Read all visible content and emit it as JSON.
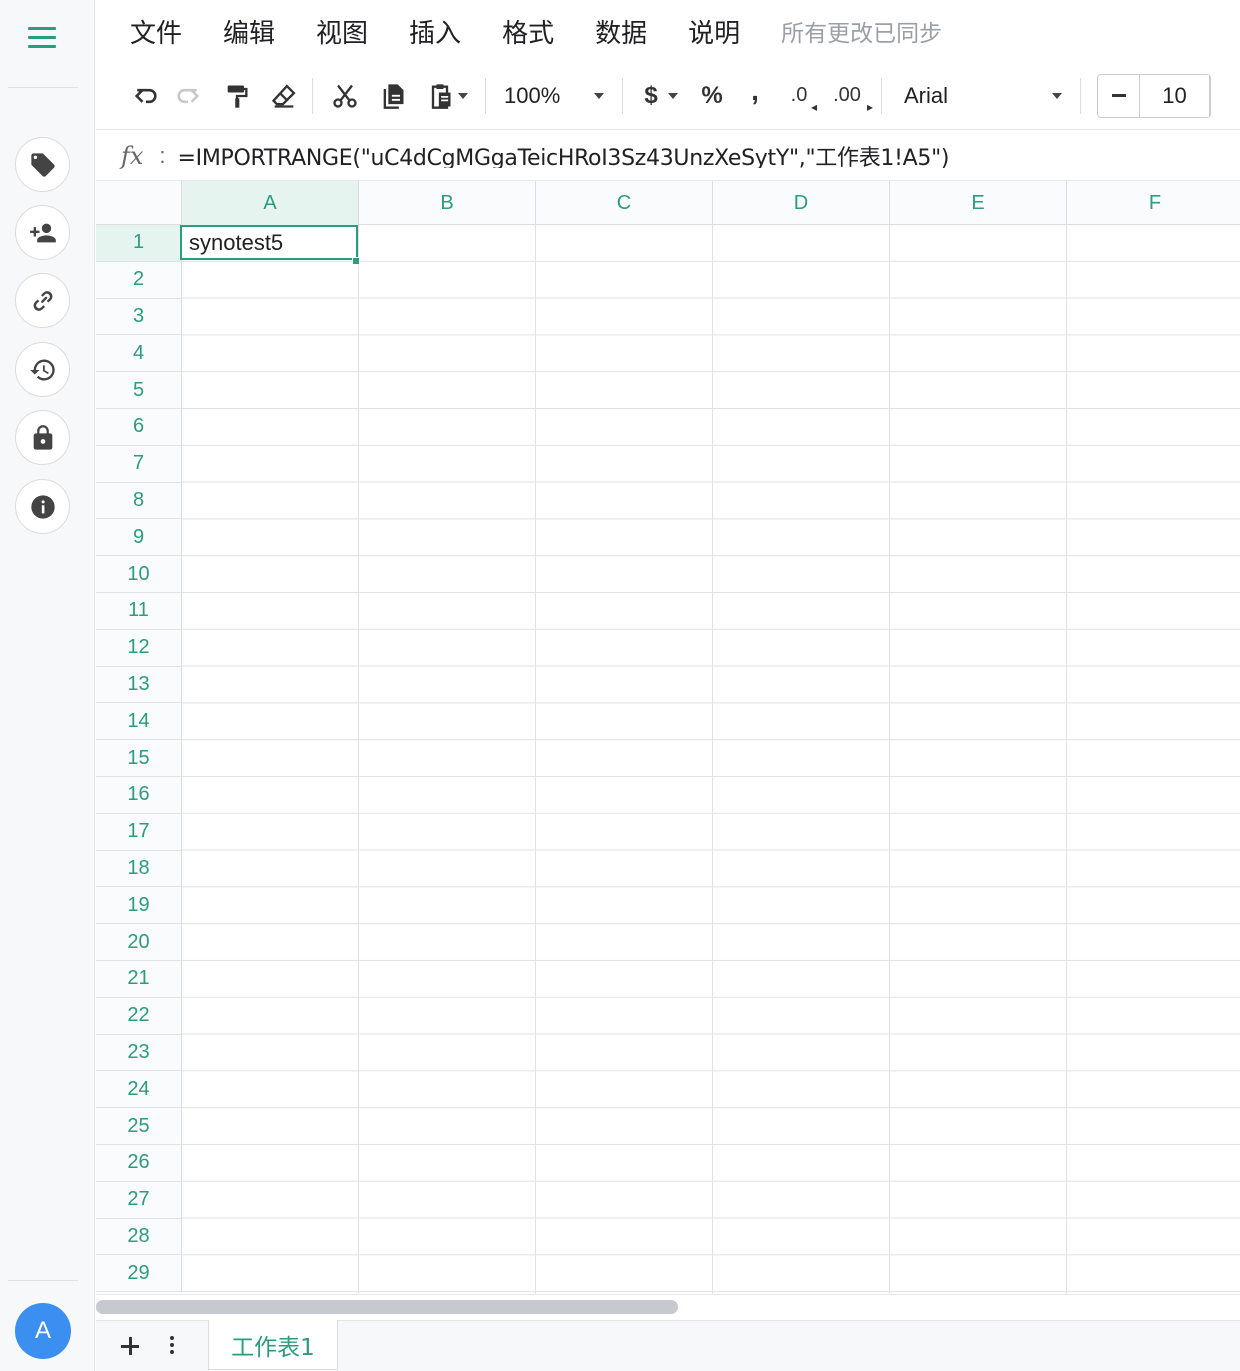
{
  "menubar": {
    "items": [
      "文件",
      "编辑",
      "视图",
      "插入",
      "格式",
      "数据",
      "说明"
    ],
    "sync_status": "所有更改已同步"
  },
  "toolbar": {
    "zoom": "100%",
    "currency_symbol": "$",
    "percent_symbol": "%",
    "comma_symbol": ",",
    "decrease_decimal": ".0",
    "increase_decimal": ".00",
    "font_family": "Arial",
    "font_size": "10"
  },
  "formula_bar": {
    "fx_label": "fx",
    "colon": ":",
    "formula": "=IMPORTRANGE(\"uC4dCgMGgaTeicHRoI3Sz43UnzXeSytY\",\"工作表1!A5\")"
  },
  "grid": {
    "columns": [
      "A",
      "B",
      "C",
      "D",
      "E",
      "F"
    ],
    "rows": [
      "1",
      "2",
      "3",
      "4",
      "5",
      "6",
      "7",
      "8",
      "9",
      "10",
      "11",
      "12",
      "13",
      "14",
      "15",
      "16",
      "17",
      "18",
      "19",
      "20",
      "21",
      "22",
      "23",
      "24",
      "25",
      "26",
      "27",
      "28",
      "29"
    ],
    "active_cell": {
      "ref": "A1",
      "value": "synotest5"
    }
  },
  "sidebar": {
    "icons": [
      "tag-icon",
      "add-user-icon",
      "link-icon",
      "history-icon",
      "lock-icon",
      "info-icon"
    ],
    "avatar_letter": "A"
  },
  "sheets": {
    "tabs": [
      "工作表1"
    ]
  },
  "colors": {
    "accent": "#2a9d7c",
    "avatar": "#3a8ff0"
  }
}
